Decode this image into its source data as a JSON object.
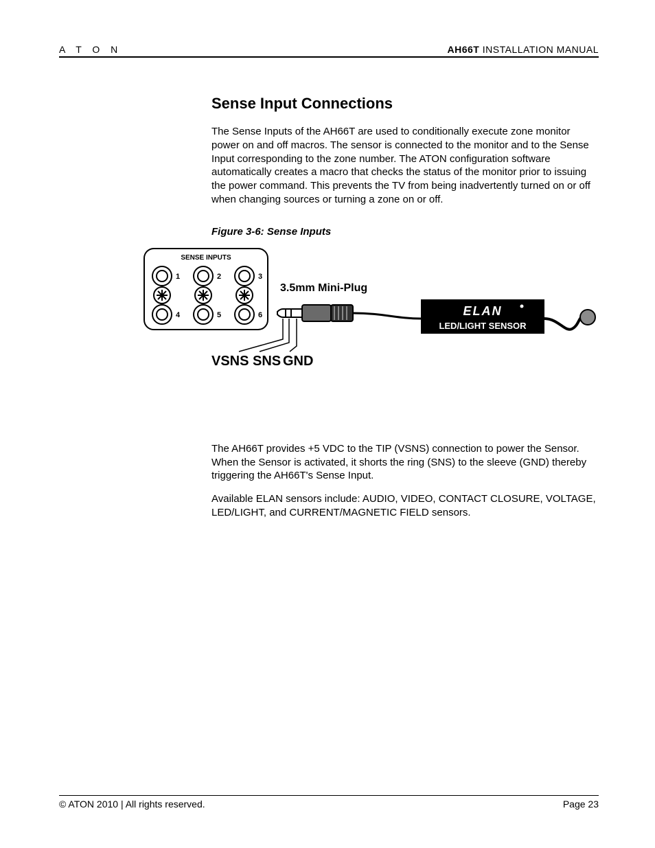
{
  "header": {
    "brand": "A T O N",
    "doc_code": "AH66T",
    "doc_title": " INSTALLATION MANUAL"
  },
  "section": {
    "title": "Sense Input Connections",
    "para1": "The Sense Inputs of the AH66T are used to conditionally execute zone monitor power on and off macros.  The sensor is connected to the monitor and to the Sense Input corresponding to the zone number.  The ATON configuration software automatically creates a macro that checks the status of the monitor prior to issuing the power command.  This prevents the TV from being inadvertently turned on or off when changing sources or turning a zone on or off.",
    "fig_caption": "Figure 3-6: Sense Inputs",
    "para2": "The AH66T provides +5 VDC to the TIP (VSNS) connection to power the Sensor.  When the Sensor is activated, it shorts the ring (SNS) to the sleeve (GND) thereby triggering the AH66T's Sense Input.",
    "para3": "Available ELAN sensors include: AUDIO, VIDEO, CONTACT CLOSURE, VOLTAGE, LED/LIGHT, and CURRENT/MAGNETIC FIELD sensors."
  },
  "figure": {
    "panel_label": "SENSE INPUTS",
    "jack_labels": [
      "1",
      "2",
      "3",
      "4",
      "5",
      "6"
    ],
    "plug_label": "3.5mm Mini-Plug",
    "pin_labels": [
      "VSNS",
      "SNS",
      "GND"
    ],
    "sensor_brand_top": "ELAN",
    "sensor_brand_bottom": "LED/LIGHT SENSOR"
  },
  "footer": {
    "copyright": "© ATON 2010 | All rights reserved.",
    "page": "Page 23"
  }
}
